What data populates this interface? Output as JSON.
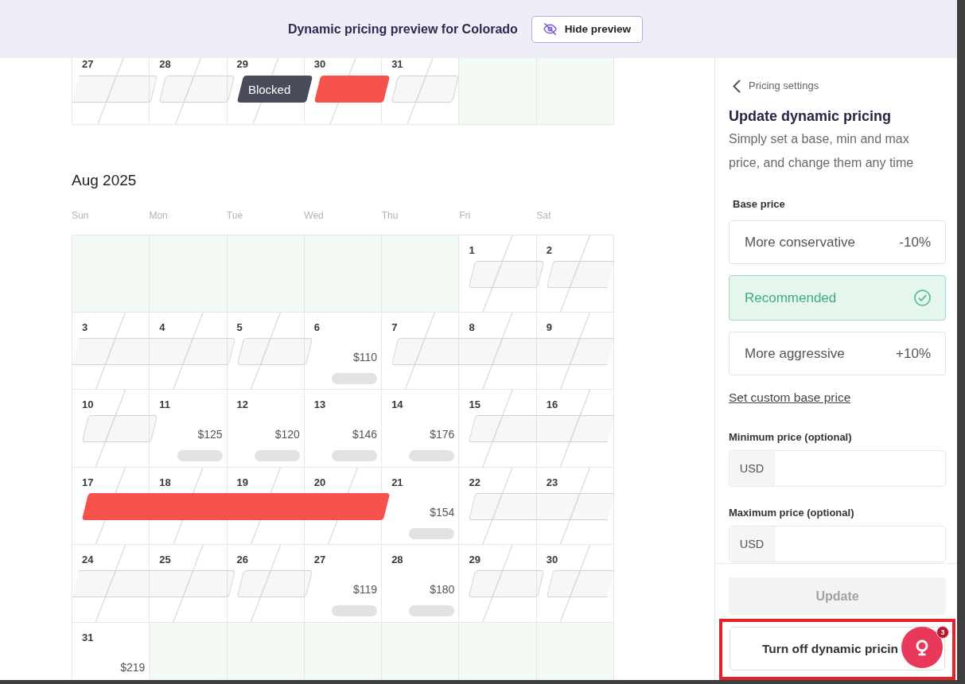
{
  "banner": {
    "title": "Dynamic pricing preview for Colorado",
    "button": "Hide preview"
  },
  "calendar": {
    "months": [
      {
        "weeks": [
          {
            "runs": [
              {
                "bar": {
                  "kind": "open",
                  "continued": true
                },
                "days": [
                  {
                    "kind": "day",
                    "number": "27",
                    "hatched": true
                  }
                ]
              },
              {
                "bar": {
                  "kind": "open",
                  "continued": false
                },
                "days": [
                  {
                    "kind": "day",
                    "number": "28",
                    "hatched": true
                  }
                ]
              },
              {
                "bar": {
                  "kind": "blocked",
                  "continued": false,
                  "label": "Blocked"
                },
                "days": [
                  {
                    "kind": "day",
                    "number": "29",
                    "hatched": true
                  }
                ]
              },
              {
                "bar": {
                  "kind": "booked",
                  "continued": false
                },
                "days": [
                  {
                    "kind": "day",
                    "number": "30",
                    "hatched": true
                  }
                ]
              },
              {
                "bar": {
                  "kind": "open",
                  "continued": false
                },
                "days": [
                  {
                    "kind": "day",
                    "number": "31",
                    "hatched": true
                  }
                ]
              },
              {
                "days": [
                  {
                    "kind": "outside"
                  },
                  {
                    "kind": "outside"
                  }
                ]
              }
            ]
          }
        ]
      },
      {
        "title": "Aug 2025",
        "weekdays": [
          "Sun",
          "Mon",
          "Tue",
          "Wed",
          "Thu",
          "Fri",
          "Sat"
        ],
        "weeks": [
          {
            "runs": [
              {
                "days": [
                  {
                    "kind": "outside"
                  },
                  {
                    "kind": "outside"
                  },
                  {
                    "kind": "outside"
                  },
                  {
                    "kind": "outside"
                  },
                  {
                    "kind": "outside"
                  }
                ]
              },
              {
                "bar": {
                  "kind": "open",
                  "continued": false
                },
                "days": [
                  {
                    "kind": "day",
                    "number": "1",
                    "hatched": true
                  }
                ]
              },
              {
                "bar": {
                  "kind": "open",
                  "continued": false
                },
                "days": [
                  {
                    "kind": "day",
                    "number": "2",
                    "hatched": true
                  }
                ]
              }
            ]
          },
          {
            "runs": [
              {
                "bar": {
                  "kind": "open",
                  "continued": true
                },
                "days": [
                  {
                    "kind": "day",
                    "number": "3",
                    "hatched": true
                  },
                  {
                    "kind": "day",
                    "number": "4",
                    "hatched": true
                  }
                ]
              },
              {
                "bar": {
                  "kind": "open",
                  "continued": false
                },
                "days": [
                  {
                    "kind": "day",
                    "number": "5",
                    "hatched": true
                  }
                ]
              },
              {
                "days": [
                  {
                    "kind": "day",
                    "number": "6",
                    "hatched": false,
                    "price": "$110",
                    "skeleton": true
                  }
                ]
              },
              {
                "bar": {
                  "kind": "open",
                  "continued": false
                },
                "days": [
                  {
                    "kind": "day",
                    "number": "7",
                    "hatched": true
                  },
                  {
                    "kind": "day",
                    "number": "8",
                    "hatched": true
                  },
                  {
                    "kind": "day",
                    "number": "9",
                    "hatched": true
                  }
                ]
              }
            ]
          },
          {
            "runs": [
              {
                "bar": {
                  "kind": "open",
                  "continued": false
                },
                "days": [
                  {
                    "kind": "day",
                    "number": "10",
                    "hatched": true
                  }
                ]
              },
              {
                "days": [
                  {
                    "kind": "day",
                    "number": "11",
                    "hatched": false,
                    "price": "$125",
                    "skeleton": true
                  },
                  {
                    "kind": "day",
                    "number": "12",
                    "hatched": false,
                    "price": "$120",
                    "skeleton": true
                  },
                  {
                    "kind": "day",
                    "number": "13",
                    "hatched": false,
                    "price": "$146",
                    "skeleton": true
                  },
                  {
                    "kind": "day",
                    "number": "14",
                    "hatched": false,
                    "price": "$176",
                    "skeleton": true
                  }
                ]
              },
              {
                "bar": {
                  "kind": "open",
                  "continued": false
                },
                "days": [
                  {
                    "kind": "day",
                    "number": "15",
                    "hatched": true
                  },
                  {
                    "kind": "day",
                    "number": "16",
                    "hatched": true
                  }
                ]
              }
            ]
          },
          {
            "runs": [
              {
                "bar": {
                  "kind": "booked",
                  "continued": false
                },
                "days": [
                  {
                    "kind": "day",
                    "number": "17",
                    "hatched": true
                  },
                  {
                    "kind": "day",
                    "number": "18",
                    "hatched": true
                  },
                  {
                    "kind": "day",
                    "number": "19",
                    "hatched": true
                  },
                  {
                    "kind": "day",
                    "number": "20",
                    "hatched": true
                  }
                ]
              },
              {
                "days": [
                  {
                    "kind": "day",
                    "number": "21",
                    "hatched": false,
                    "price": "$154",
                    "skeleton": true
                  }
                ]
              },
              {
                "bar": {
                  "kind": "open",
                  "continued": false
                },
                "days": [
                  {
                    "kind": "day",
                    "number": "22",
                    "hatched": true
                  },
                  {
                    "kind": "day",
                    "number": "23",
                    "hatched": true
                  }
                ]
              }
            ]
          },
          {
            "runs": [
              {
                "bar": {
                  "kind": "open",
                  "continued": true
                },
                "days": [
                  {
                    "kind": "day",
                    "number": "24",
                    "hatched": true
                  },
                  {
                    "kind": "day",
                    "number": "25",
                    "hatched": true
                  }
                ]
              },
              {
                "bar": {
                  "kind": "open",
                  "continued": false
                },
                "days": [
                  {
                    "kind": "day",
                    "number": "26",
                    "hatched": true
                  }
                ]
              },
              {
                "days": [
                  {
                    "kind": "day",
                    "number": "27",
                    "hatched": false,
                    "price": "$119",
                    "skeleton": true
                  },
                  {
                    "kind": "day",
                    "number": "28",
                    "hatched": false,
                    "price": "$180",
                    "skeleton": true
                  }
                ]
              },
              {
                "bar": {
                  "kind": "open",
                  "continued": false
                },
                "days": [
                  {
                    "kind": "day",
                    "number": "29",
                    "hatched": true
                  }
                ]
              },
              {
                "bar": {
                  "kind": "open",
                  "continued": false
                },
                "days": [
                  {
                    "kind": "day",
                    "number": "30",
                    "hatched": true
                  }
                ]
              }
            ]
          },
          {
            "runs": [
              {
                "days": [
                  {
                    "kind": "day",
                    "number": "31",
                    "hatched": false,
                    "price": "$219",
                    "skeleton": false
                  },
                  {
                    "kind": "outside"
                  },
                  {
                    "kind": "outside"
                  },
                  {
                    "kind": "outside"
                  },
                  {
                    "kind": "outside"
                  },
                  {
                    "kind": "outside"
                  },
                  {
                    "kind": "outside"
                  }
                ]
              }
            ]
          }
        ]
      }
    ]
  },
  "panel": {
    "back_link": "Pricing settings",
    "title": "Update dynamic pricing",
    "description": "Simply set a base, min and max price, and change them any time",
    "base_price": {
      "label": "Base price",
      "options": [
        {
          "label": "More conservative",
          "value": "-10%",
          "selected": false
        },
        {
          "label": "Recommended",
          "selected": true
        },
        {
          "label": "More aggressive",
          "value": "+10%",
          "selected": false
        }
      ]
    },
    "custom_link": "Set custom base price",
    "fields": [
      {
        "label": "Minimum price (optional)",
        "prefix": "USD"
      },
      {
        "label": "Maximum price (optional)",
        "prefix": "USD"
      }
    ],
    "update_button": {
      "label": "Update",
      "disabled": true
    },
    "turn_off_button": {
      "label": "Turn off dynamic pricin",
      "highlighted": true
    }
  },
  "help_bubble": {
    "badge": "3"
  }
}
